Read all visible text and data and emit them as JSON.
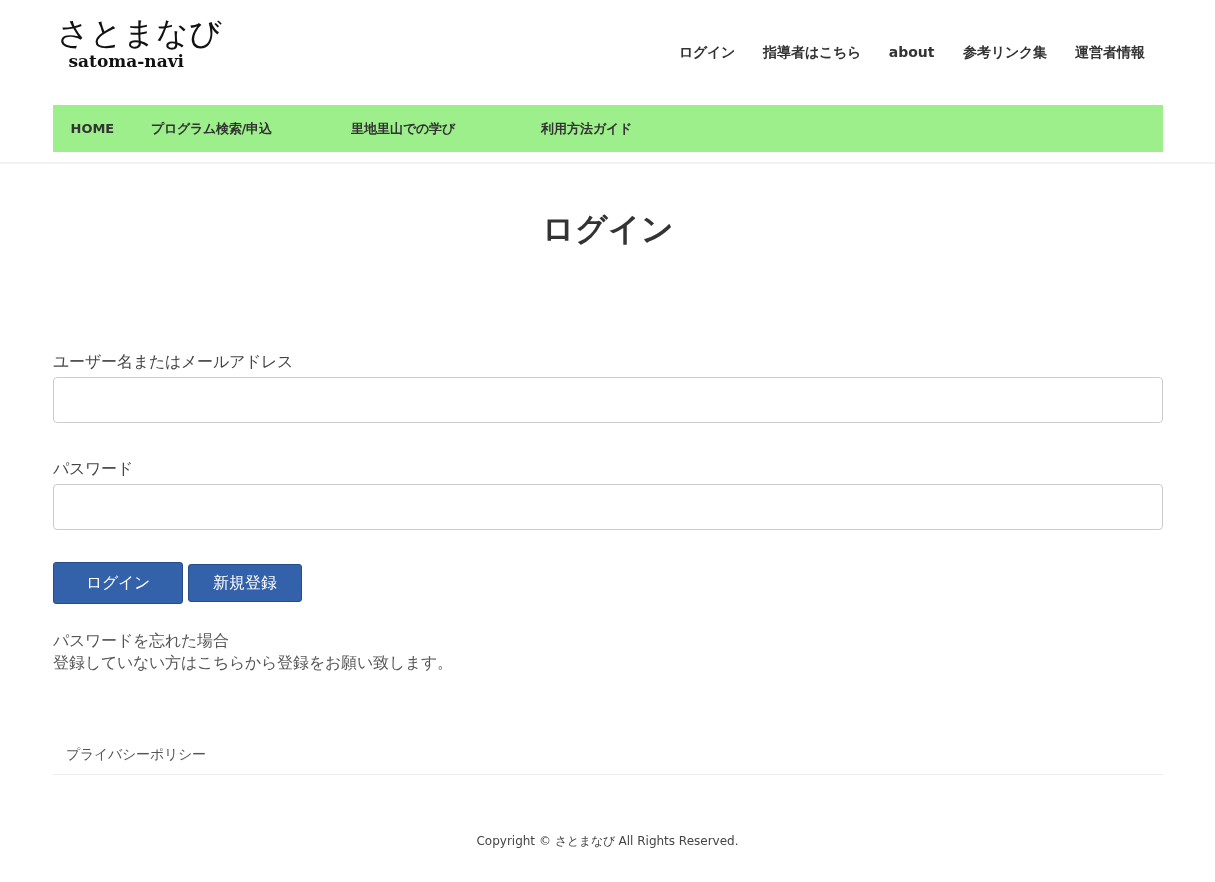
{
  "logo": {
    "title": "さとまなび",
    "subtitle": "satoma-navi"
  },
  "top_nav": [
    "ログイン",
    "指導者はこちら",
    "about",
    "参考リンク集",
    "運営者情報"
  ],
  "main_nav": [
    "HOME",
    "プログラム検索/申込",
    "里地里山での学び",
    "利用方法ガイド"
  ],
  "page_title": "ログイン",
  "form": {
    "fields": [
      {
        "label": "ユーザー名またはメールアドレス"
      },
      {
        "label": "パスワード"
      }
    ],
    "buttons": [
      "ログイン",
      "新規登録"
    ]
  },
  "links": [
    "パスワードを忘れた場合",
    "登録していない方はこちらから登録をお願い致します。"
  ],
  "footer": {
    "menu": [
      "プライバシーポリシー"
    ],
    "copyright": "Copyright © さとまなび All Rights Reserved."
  }
}
